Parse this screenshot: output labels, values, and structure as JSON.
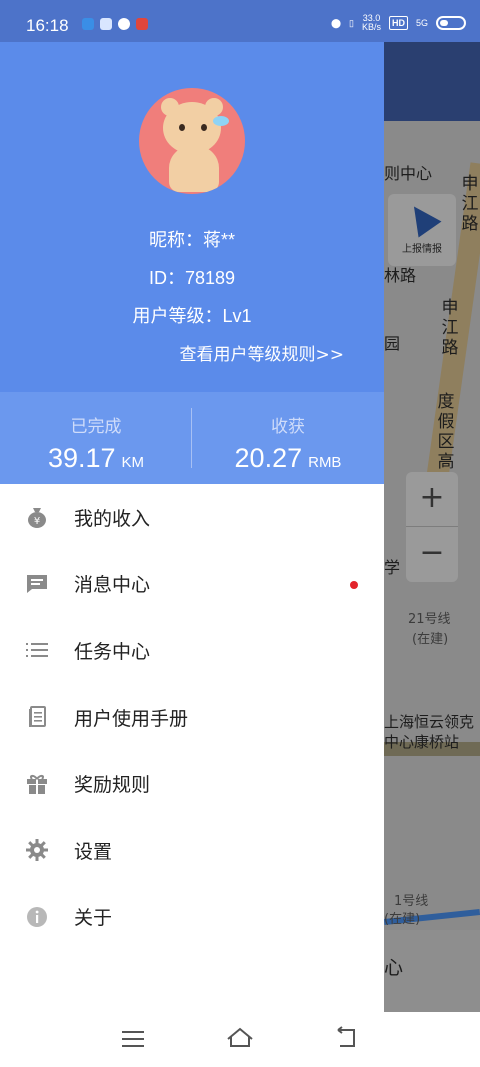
{
  "status_bar": {
    "time": "16:18",
    "speed_value": "33.0",
    "speed_unit": "KB/s",
    "hd": "HD",
    "network": "5G"
  },
  "map": {
    "labels": [
      "则中心",
      "申江路",
      "林路",
      "园",
      "申江路",
      "度假区高",
      "学",
      "21号线",
      "(在建)",
      "上海恒云领克中心康桥站",
      "1号线",
      "(在建)",
      "心"
    ],
    "report_label": "上报情报",
    "zoom_in": "+",
    "zoom_out": "−"
  },
  "profile": {
    "nickname": "昵称：蒋**",
    "user_id": "ID：78189",
    "level": "用户等级：Lv1",
    "level_link": "查看用户等级规则>>"
  },
  "stats": {
    "completed_label": "已完成",
    "completed_value": "39.17",
    "completed_unit": "KM",
    "harvest_label": "收获",
    "harvest_value": "20.27",
    "harvest_unit": "RMB"
  },
  "menu": {
    "items": [
      {
        "label": "我的收入",
        "icon": "money-bag-icon"
      },
      {
        "label": "消息中心",
        "icon": "message-icon",
        "badge": true
      },
      {
        "label": "任务中心",
        "icon": "list-icon"
      },
      {
        "label": "用户使用手册",
        "icon": "manual-icon"
      },
      {
        "label": "奖励规则",
        "icon": "gift-icon"
      },
      {
        "label": "设置",
        "icon": "gear-icon"
      },
      {
        "label": "关于",
        "icon": "info-icon"
      }
    ]
  },
  "colors": {
    "profile_bg": "#5b8bea",
    "stats_bg": "#6b98ee",
    "badge": "#e3242b"
  }
}
